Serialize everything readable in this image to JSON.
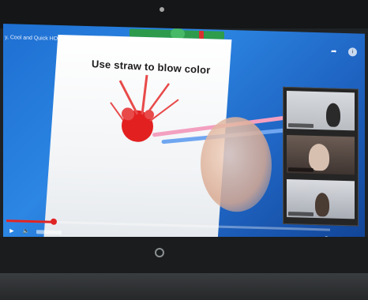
{
  "video": {
    "title": "y, Cool and Quick HOLI Craft | HOLI fun craft | HOLI IDEAS",
    "caption": "Use straw to blow color"
  },
  "colors": {
    "paint": "#e32020",
    "screen_blue": "#1f6fd1",
    "progress": "#e02424",
    "zoom_green": "#2e9e3b"
  },
  "icons": {
    "share": "share-icon",
    "info": "info-icon",
    "play": "play-icon",
    "volume": "volume-icon",
    "settings": "settings-icon",
    "fullscreen": "fullscreen-icon"
  }
}
